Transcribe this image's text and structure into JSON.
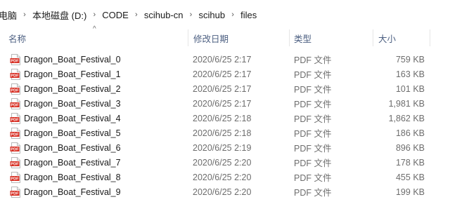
{
  "breadcrumb": [
    {
      "label": "电脑"
    },
    {
      "label": "本地磁盘 (D:)"
    },
    {
      "label": "CODE"
    },
    {
      "label": "scihub-cn"
    },
    {
      "label": "scihub"
    },
    {
      "label": "files"
    }
  ],
  "columns": {
    "name": "名称",
    "date": "修改日期",
    "type": "类型",
    "size": "大小"
  },
  "files": [
    {
      "name": "Dragon_Boat_Festival_0",
      "date": "2020/6/25 2:17",
      "type": "PDF 文件",
      "size": "759 KB",
      "icon": "pdf-file-icon"
    },
    {
      "name": "Dragon_Boat_Festival_1",
      "date": "2020/6/25 2:17",
      "type": "PDF 文件",
      "size": "163 KB",
      "icon": "pdf-file-icon"
    },
    {
      "name": "Dragon_Boat_Festival_2",
      "date": "2020/6/25 2:17",
      "type": "PDF 文件",
      "size": "101 KB",
      "icon": "pdf-file-icon"
    },
    {
      "name": "Dragon_Boat_Festival_3",
      "date": "2020/6/25 2:17",
      "type": "PDF 文件",
      "size": "1,981 KB",
      "icon": "pdf-file-icon"
    },
    {
      "name": "Dragon_Boat_Festival_4",
      "date": "2020/6/25 2:18",
      "type": "PDF 文件",
      "size": "1,862 KB",
      "icon": "pdf-file-icon"
    },
    {
      "name": "Dragon_Boat_Festival_5",
      "date": "2020/6/25 2:18",
      "type": "PDF 文件",
      "size": "186 KB",
      "icon": "pdf-file-icon"
    },
    {
      "name": "Dragon_Boat_Festival_6",
      "date": "2020/6/25 2:19",
      "type": "PDF 文件",
      "size": "896 KB",
      "icon": "pdf-file-icon"
    },
    {
      "name": "Dragon_Boat_Festival_7",
      "date": "2020/6/25 2:20",
      "type": "PDF 文件",
      "size": "178 KB",
      "icon": "pdf-file-icon"
    },
    {
      "name": "Dragon_Boat_Festival_8",
      "date": "2020/6/25 2:20",
      "type": "PDF 文件",
      "size": "455 KB",
      "icon": "pdf-file-icon"
    },
    {
      "name": "Dragon_Boat_Festival_9",
      "date": "2020/6/25 2:20",
      "type": "PDF 文件",
      "size": "199 KB",
      "icon": "pdf-file-icon"
    }
  ],
  "colors": {
    "pdf_red": "#d72c20",
    "header_text": "#4d6082",
    "secondary_text": "#6d6d6d"
  }
}
